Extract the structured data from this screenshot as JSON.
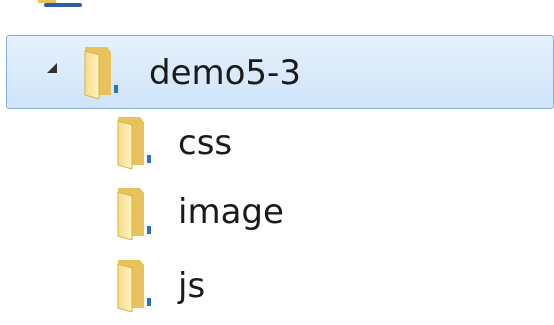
{
  "tree": {
    "root": {
      "label": "demo5-3",
      "expanded": true,
      "selected": true,
      "icon": "folder-icon",
      "children": [
        {
          "label": "css",
          "icon": "folder-icon"
        },
        {
          "label": "image",
          "icon": "folder-icon"
        },
        {
          "label": "js",
          "icon": "folder-icon"
        }
      ]
    },
    "colors": {
      "selection_top": "#e6f1fc",
      "selection_bottom": "#cfe4f9",
      "selection_border": "#84acdd",
      "folder_light": "#fbe9a6",
      "folder_dark": "#e8c35b"
    }
  }
}
